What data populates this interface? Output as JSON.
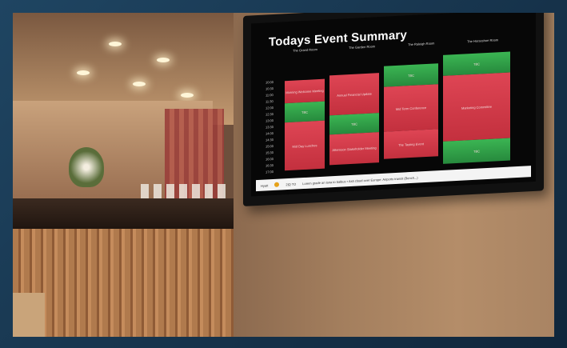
{
  "screen": {
    "title": "Todays Event Summary",
    "rooms": [
      "The Grand Room",
      "The Garden Room",
      "The Raleigh Room",
      "The Horseshoe Room"
    ],
    "times": [
      "10:00",
      "10:30",
      "11:00",
      "11:30",
      "12:00",
      "12:30",
      "13:00",
      "13:30",
      "14:00",
      "14:30",
      "15:00",
      "15:30",
      "16:00",
      "16:30",
      "17:00"
    ],
    "events": [
      {
        "label": "Morning Welcome Meeting",
        "color": "red"
      },
      {
        "label": "TBC",
        "color": "green"
      },
      {
        "label": "Mid Day Lunches",
        "color": "red"
      },
      {
        "label": "Annual Financial Update",
        "color": "red"
      },
      {
        "label": "TBC",
        "color": "green"
      },
      {
        "label": "Afternoon Stakeholder Meeting",
        "color": "red"
      },
      {
        "label": "TBC",
        "color": "green"
      },
      {
        "label": "Mid Term Conference",
        "color": "red"
      },
      {
        "label": "The Tasting Event",
        "color": "red"
      },
      {
        "label": "TBC",
        "color": "green"
      },
      {
        "label": "Marketing Committee",
        "color": "red"
      },
      {
        "label": "TBC",
        "color": "green"
      }
    ],
    "footer": {
      "logo_text": "Hyatt",
      "brand": "2|Q TO",
      "ticker": "Lorem grade an lana to balbus  •  Ash cloud over Europe: Airports transit (Bench...)"
    }
  },
  "colors": {
    "red": "#d23b49",
    "green": "#33a64a"
  }
}
